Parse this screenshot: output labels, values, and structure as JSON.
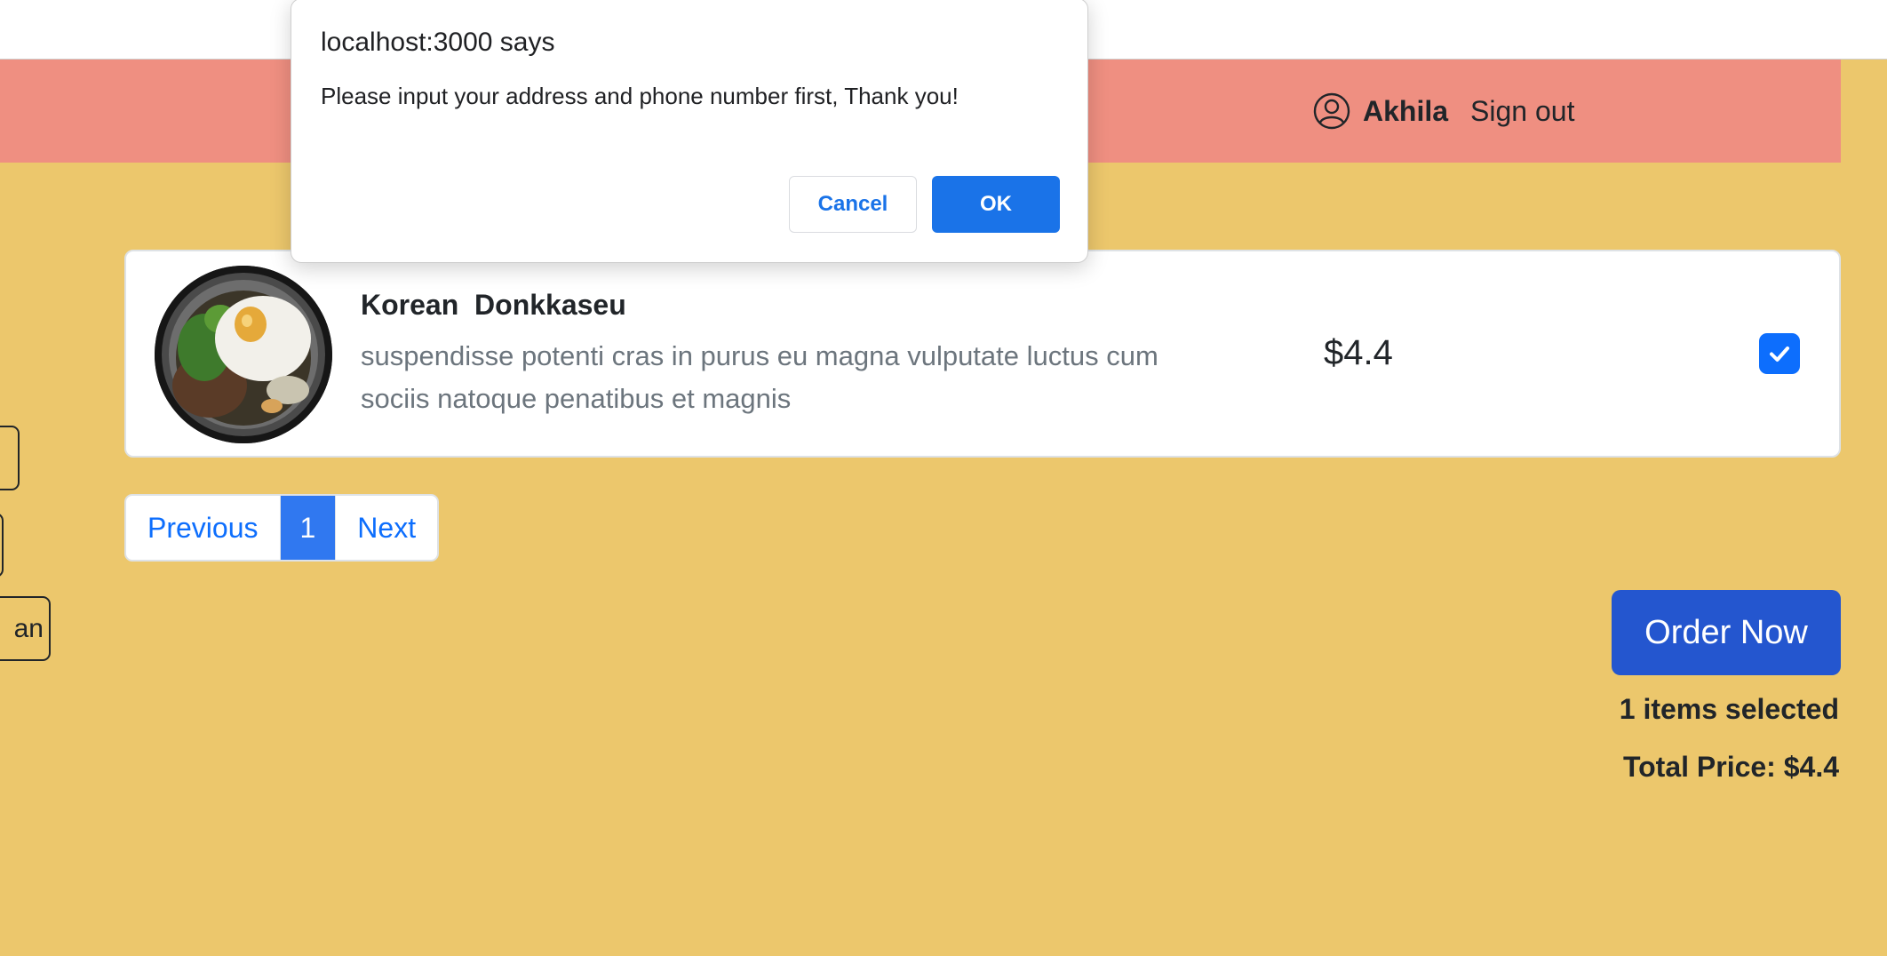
{
  "header": {
    "user_name": "Akhila",
    "signout_label": "Sign out",
    "user_icon": "person-circle-icon"
  },
  "side_filters": {
    "third_visible_text": "an"
  },
  "menu_item": {
    "title": "Korean  Donkkaseu",
    "description": "suspendisse potenti cras in purus eu magna vulputate luctus cum sociis natoque penatibus et magnis",
    "price": "$4.4",
    "checked": true,
    "check_icon": "checkmark-icon"
  },
  "pagination": {
    "previous_label": "Previous",
    "current_page": "1",
    "next_label": "Next"
  },
  "order": {
    "button_label": "Order Now",
    "items_selected": "1 items selected",
    "total_price": "Total Price: $4.4"
  },
  "dialog": {
    "title": "localhost:3000 says",
    "message": "Please input your address and phone number first, Thank you!",
    "cancel_label": "Cancel",
    "ok_label": "OK"
  },
  "colors": {
    "page_background": "#ecc76c",
    "navbar": "#ef8f81",
    "primary": "#0d6efd",
    "order_button": "#2456cf",
    "dialog_ok": "#1a73e8"
  }
}
